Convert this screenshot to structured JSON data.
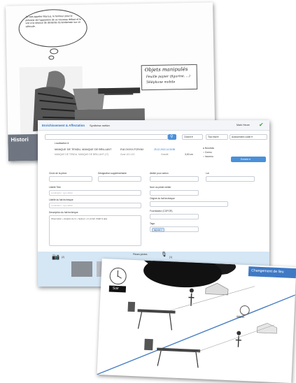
{
  "panel1": {
    "thought": "Je vais appeler Marcus, le fermeur pour le prévenir de l'apparition de ce nouveau défaut et le voir à la séance de démérite du lendemain sur ce véhicule.",
    "note_title": "Objets manipulés",
    "note_items": [
      "Feuille papier (figurine, ...)",
      "Téléphone mobile"
    ],
    "history_label": "Histori",
    "fragments": [
      "N°Sou",
      "8 du",
      "2/178"
    ]
  },
  "panel2": {
    "tabs": [
      "Enrichissement & Affectation",
      "Synthèse métier"
    ],
    "user": "Mark Heure",
    "dropdowns": [
      "Ouvert ▾",
      "Tout état ▾",
      "Avancement coûté ▾"
    ],
    "location_label": "Localisation ▾",
    "record_title": "MANQUE DE TENDU, MANQUE DE BRILLANT",
    "record_sub": "MANQUE DE TENDU, MANQUE DE BRILLANT (17)",
    "record_code": "EVA OXXVX-PCRXNX",
    "record_code2": "25.12.2015 14:30:55",
    "record_meta": [
      "Zone 101 12C",
      "Gravité",
      "3,00 cm"
    ],
    "radio_options": [
      "Nouveau",
      "Connu",
      "Inconnu"
    ],
    "action_button": "Enrichir ▾",
    "left_fields": [
      "Choix de la pièce",
      "Désignation supplémentaire",
      "Libellé Titre",
      "Libellé du fait technique",
      "Description du fait technique"
    ],
    "left_placeholders": [
      "Localisation : type défaut",
      "Localisation : type défaut"
    ],
    "description_text": "Observation + situation de tri + hauteur + tri (si IQF d'AEP & qlte)",
    "right_fields": [
      "Atelier pour action",
      "Lot",
      "Nom du pilote métier",
      "Origine du fait technique",
      "Fournisseur (COFOR)",
      "Tags"
    ],
    "tag": "tag test ×",
    "pieces_label": "Pièces jointes",
    "photo_count": "(2)",
    "audio_count": "(1)"
  },
  "panel3": {
    "banner": "Changement de lieu",
    "evening": "Soir",
    "morning": "Matin"
  }
}
